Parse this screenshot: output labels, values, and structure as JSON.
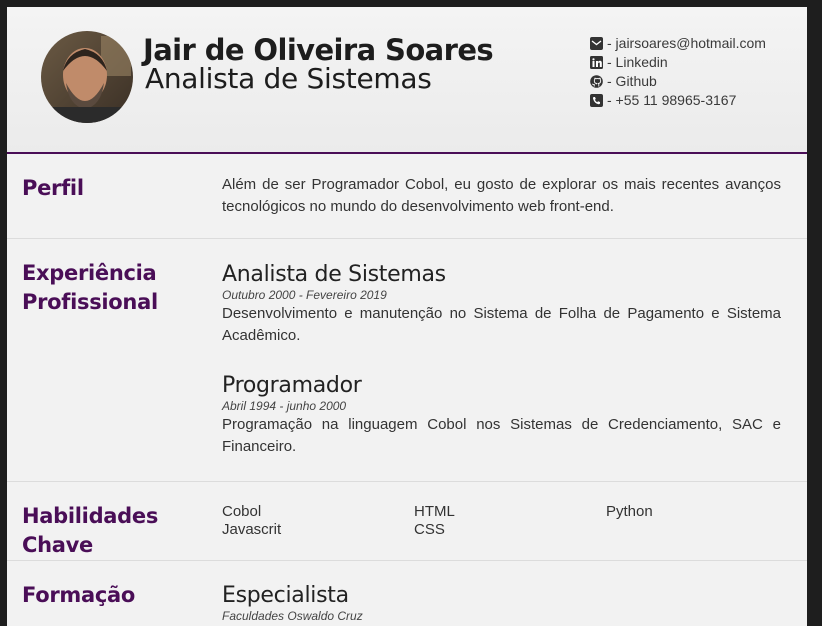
{
  "header": {
    "name": "Jair de Oliveira Soares",
    "role": "Analista de Sistemas",
    "contacts": [
      {
        "icon": "email-icon",
        "text": "- jairsoares@hotmail.com"
      },
      {
        "icon": "linkedin-icon",
        "text": "- Linkedin"
      },
      {
        "icon": "github-icon",
        "text": "- Github"
      },
      {
        "icon": "phone-icon",
        "text": "- +55 11 98965-3167"
      }
    ]
  },
  "profile": {
    "title": "Perfil",
    "text": "Além de ser Programador Cobol, eu gosto de explorar os mais recentes avanços tecnológicos no mundo do desenvolvimento web front-end."
  },
  "experience": {
    "title_line1": "Experiência",
    "title_line2": "Profissional",
    "jobs": [
      {
        "title": "Analista de Sistemas",
        "period": "Outubro 2000 - Fevereiro 2019",
        "desc": "Desenvolvimento e manutenção no Sistema de Folha de Pagamento e Sistema Acadêmico."
      },
      {
        "title": "Programador",
        "period": "Abril 1994 - junho 2000",
        "desc": "Programação na linguagem Cobol nos Sistemas de Credenciamento, SAC e Financeiro."
      }
    ]
  },
  "skills": {
    "title_line1": "Habilidades",
    "title_line2": "Chave",
    "items": [
      "Cobol",
      "HTML",
      "Python",
      "Javascrit",
      "CSS"
    ]
  },
  "education": {
    "title": "Formação",
    "degree": "Especialista",
    "school": "Faculdades Oswaldo Cruz"
  },
  "colors": {
    "accent": "#4a0e57",
    "background": "#f2f2f2",
    "frame": "#1e1e1e"
  }
}
